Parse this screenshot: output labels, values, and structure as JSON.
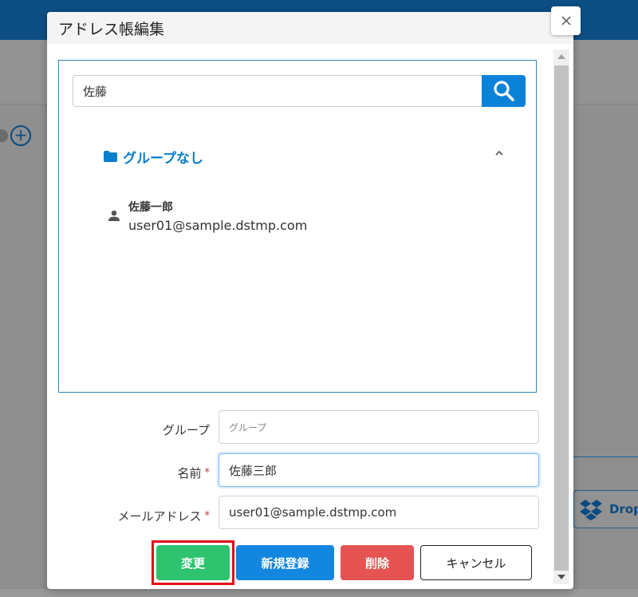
{
  "modal": {
    "title": "アドレス帳編集",
    "close_icon": "close-icon"
  },
  "address_book": {
    "search_value": "佐藤",
    "search_icon": "search-icon",
    "group": {
      "name": "グループなし",
      "icon": "folder-icon",
      "toggle_icon": "chevron-up-icon"
    },
    "contacts": [
      {
        "name": "佐藤一郎",
        "email": "user01@sample.dstmp.com",
        "icon": "person-icon"
      }
    ]
  },
  "form": {
    "group_label": "グループ",
    "group_placeholder": "グループ",
    "group_value": "",
    "name_label": "名前",
    "name_value": "佐藤三郎",
    "email_label": "メールアドレス",
    "email_value": "user01@sample.dstmp.com",
    "required_mark": "*"
  },
  "buttons": {
    "change": "変更",
    "new_register": "新規登録",
    "delete": "削除",
    "cancel": "キャンセル"
  },
  "background": {
    "dropbox_label": "Drop",
    "plus_label": "+"
  },
  "colors": {
    "accent": "#0a82d8",
    "change": "#2ec36f",
    "delete": "#e55353",
    "highlight": "#e0101a"
  }
}
